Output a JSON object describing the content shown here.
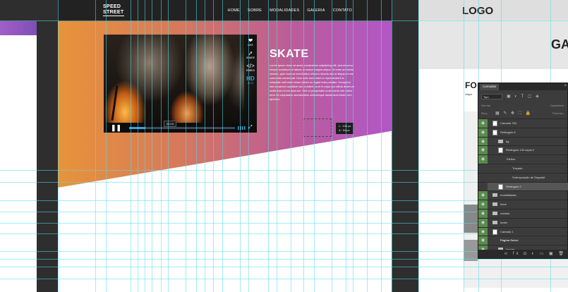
{
  "nav": {
    "logo_line1": "SPEED",
    "logo_line2": "STREET",
    "menu": [
      "HOME",
      "SOBRE",
      "MODALIDADES",
      "GALERIA",
      "CONTATO"
    ]
  },
  "video": {
    "side_items": [
      {
        "icon": "❤",
        "label": "LIKE"
      },
      {
        "icon": "➚",
        "label": "SHARE"
      },
      {
        "icon": "</>",
        "label": "EMBED"
      },
      {
        "icon": "HD",
        "label": "ALTA"
      }
    ],
    "pause_icon": "❚❚",
    "time_tip": "00:15",
    "fullscreen_icon": "⤢",
    "progress_fraction": 0.15
  },
  "skate": {
    "title": "SKATE",
    "text": "Lorem ipsum dolor sit amet, consectetur adipisicing elit, sed eiusmod tempor incididunt ut labore et dolore magna aliqua. Ut enim ad minim veniam, quis nostrud exercitation ullamco laboris nisi ut aliquip ex ea commodo consequat. Duis aute irure dolor in reprehenderit in voluptate velit esse cillum dolore eu fugiat nulla pariatur. Excepteur sint occaecat cupidatat non proident, sunt in culpa qui officia deserunt mollit anim id est laborum. Sed ut perspiciatis unde omnis iste natus error sit voluptatem accusantium doloremque laudantium totam rem aperiam."
  },
  "measure": {
    "line1": "L : 134 px",
    "line2": "A : 94 px"
  },
  "artboard2": {
    "logo": "LOGO",
    "partial_heading": "GA",
    "partial_title": "FO",
    "partial_small": "clique"
  },
  "layers_panel": {
    "tab": "Camadas",
    "close": "×",
    "filter_kind": "Tipo",
    "filter_icons": "▣ ◐ T ▢ ◈",
    "mode": "Normal",
    "opacity_label": "Opacidade:",
    "lock_label": "Bloq.:",
    "lock_tools": "▦ ✎ ✥ ⛶ 🔒",
    "fill_label": "Preench.:",
    "bottom_icons": "∞ fx ◘ ◐ ▭ ▣ 🗑",
    "layers": [
      {
        "name": "Camada 763",
        "visible": true,
        "kind": "thumb",
        "indent": 0
      },
      {
        "name": "Retângulo 6",
        "visible": true,
        "kind": "thumb",
        "indent": 0
      },
      {
        "name": "bg",
        "visible": true,
        "kind": "folder",
        "indent": 1
      },
      {
        "name": "Retângulo 134 cópia 2",
        "visible": true,
        "kind": "thumb",
        "indent": 1
      },
      {
        "name": "Efeitos",
        "visible": true,
        "kind": "fx",
        "indent": 2
      },
      {
        "name": "Traçado",
        "visible": false,
        "kind": "fx",
        "indent": 3
      },
      {
        "name": "Sobreposição de Degradê",
        "visible": false,
        "kind": "fx",
        "indent": 3
      },
      {
        "name": "Retângulo 2",
        "visible": false,
        "kind": "thumb",
        "indent": 1
      },
      {
        "name": "modalidades",
        "visible": true,
        "kind": "folder",
        "indent": 0
      },
      {
        "name": "fotos",
        "visible": true,
        "kind": "folder",
        "indent": 0
      },
      {
        "name": "contato",
        "visible": true,
        "kind": "folder",
        "indent": 0
      },
      {
        "name": "footer",
        "visible": true,
        "kind": "folder",
        "indent": 0
      },
      {
        "name": "Camada 1",
        "visible": true,
        "kind": "thumb",
        "indent": 0
      },
      {
        "name": "Página Sobre",
        "visible": true,
        "kind": "group",
        "indent": 0
      },
      {
        "name": "header",
        "visible": true,
        "kind": "folder",
        "indent": 1
      }
    ]
  }
}
